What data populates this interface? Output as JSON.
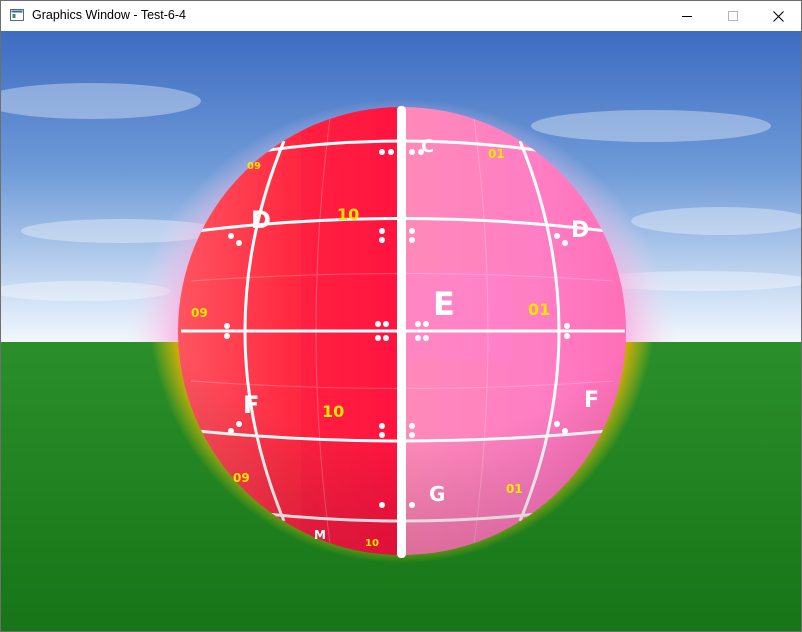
{
  "window": {
    "title": "Graphics Window - Test-6-4",
    "icon": "app-window-icon",
    "controls": {
      "minimize_icon": "minimize-icon",
      "maximize_icon": "maximize-icon",
      "close_icon": "close-icon"
    }
  },
  "scene": {
    "colors": {
      "sky_top": "#3f6fc4",
      "sky_horizon": "#e8f0fa",
      "ground": "#1f8a1f",
      "sphere_left": "#ff2a4a",
      "sphere_right": "#ff7fc4",
      "glow_top": "#ff7fcf",
      "glow_bottom": "#ff9a00",
      "label_white": "#ffffff",
      "label_yellow": "#ffe600"
    },
    "labels": {
      "c": "C",
      "d_left": "D",
      "d_right": "D",
      "e": "E",
      "f_left": "F",
      "f_right": "F",
      "g": "G",
      "n10_upper": "10",
      "n10_lower": "10",
      "n01_top": "01",
      "n01_mid": "01",
      "n01_low": "01",
      "n09_mid": "09",
      "n09_low": "09",
      "n09_top": "09",
      "n10_bottom": "10",
      "m_bottom": "M"
    }
  }
}
